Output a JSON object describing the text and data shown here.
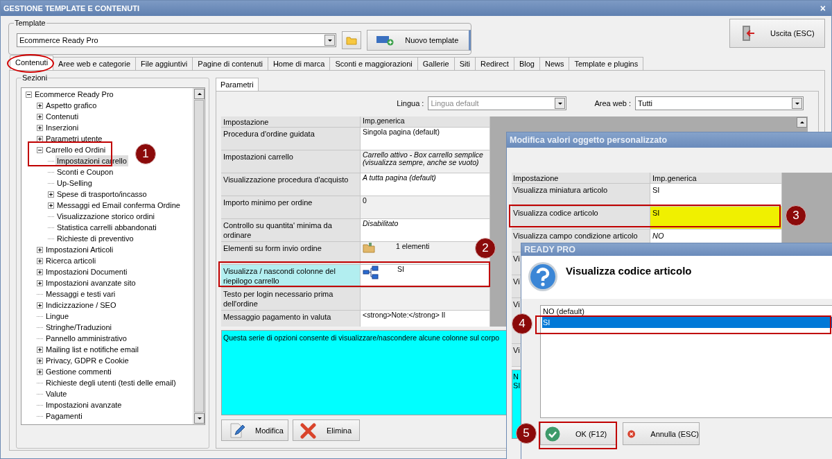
{
  "window": {
    "title": "GESTIONE TEMPLATE E CONTENUTI",
    "close": "×"
  },
  "template": {
    "legend": "Template",
    "value": "Ecommerce Ready Pro",
    "new_button": "Nuovo template"
  },
  "exit_button": "Uscita (ESC)",
  "tabs": [
    {
      "label": "Contenuti",
      "selected": true
    },
    {
      "label": "Aree web e categorie",
      "selected": false
    },
    {
      "label": "File aggiuntivi",
      "selected": false
    },
    {
      "label": "Pagine di contenuti",
      "selected": false
    },
    {
      "label": "Home di marca",
      "selected": false
    },
    {
      "label": "Sconti e maggiorazioni",
      "selected": false
    },
    {
      "label": "Gallerie",
      "selected": false
    },
    {
      "label": "Siti",
      "selected": false
    },
    {
      "label": "Redirect",
      "selected": false
    },
    {
      "label": "Blog",
      "selected": false
    },
    {
      "label": "News",
      "selected": false
    },
    {
      "label": "Template e plugins",
      "selected": false
    }
  ],
  "sections": {
    "legend": "Sezioni",
    "tree": [
      {
        "label": "Ecommerce Ready Pro",
        "kind": "node",
        "expanded": true,
        "selected": false,
        "children": [
          {
            "label": "Aspetto grafico",
            "kind": "node",
            "expanded": false,
            "selected": false
          },
          {
            "label": "Contenuti",
            "kind": "node",
            "expanded": false,
            "selected": false
          },
          {
            "label": "Inserzioni",
            "kind": "node",
            "expanded": false,
            "selected": false
          },
          {
            "label": "Parametri utente",
            "kind": "node",
            "expanded": false,
            "selected": false
          },
          {
            "label": "Carrello ed Ordini",
            "kind": "node",
            "expanded": true,
            "selected": false,
            "children": [
              {
                "label": "Impostazioni carrello",
                "kind": "leaf",
                "selected": true
              },
              {
                "label": "Sconti e Coupon",
                "kind": "leaf",
                "selected": false
              },
              {
                "label": "Up-Selling",
                "kind": "leaf",
                "selected": false
              },
              {
                "label": "Spese di trasporto/incasso",
                "kind": "node",
                "expanded": false,
                "selected": false
              },
              {
                "label": "Messaggi ed Email conferma Ordine",
                "kind": "node",
                "expanded": false,
                "selected": false
              },
              {
                "label": "Visualizzazione storico ordini",
                "kind": "leaf",
                "selected": false
              },
              {
                "label": "Statistica carrelli abbandonati",
                "kind": "leaf",
                "selected": false
              },
              {
                "label": "Richieste di preventivo",
                "kind": "leaf",
                "selected": false
              }
            ]
          },
          {
            "label": "Impostazioni Articoli",
            "kind": "node",
            "expanded": false,
            "selected": false
          },
          {
            "label": "Ricerca articoli",
            "kind": "node",
            "expanded": false,
            "selected": false
          },
          {
            "label": "Impostazioni Documenti",
            "kind": "node",
            "expanded": false,
            "selected": false
          },
          {
            "label": "Impostazioni avanzate sito",
            "kind": "node",
            "expanded": false,
            "selected": false
          },
          {
            "label": "Messaggi e testi vari",
            "kind": "leaf",
            "selected": false
          },
          {
            "label": "Indicizzazione / SEO",
            "kind": "node",
            "expanded": false,
            "selected": false
          },
          {
            "label": "Lingue",
            "kind": "leaf",
            "selected": false
          },
          {
            "label": "Stringhe/Traduzioni",
            "kind": "leaf",
            "selected": false
          },
          {
            "label": "Pannello amministrativo",
            "kind": "leaf",
            "selected": false
          },
          {
            "label": "Mailing list e notifiche email",
            "kind": "node",
            "expanded": false,
            "selected": false
          },
          {
            "label": "Privacy, GDPR e Cookie",
            "kind": "node",
            "expanded": false,
            "selected": false
          },
          {
            "label": "Gestione commenti",
            "kind": "node",
            "expanded": false,
            "selected": false
          },
          {
            "label": "Richieste degli utenti (testi delle email)",
            "kind": "leaf",
            "selected": false
          },
          {
            "label": "Valute",
            "kind": "leaf",
            "selected": false
          },
          {
            "label": "Impostazioni avanzate",
            "kind": "leaf",
            "selected": false
          },
          {
            "label": "Pagamenti",
            "kind": "leaf",
            "selected": false
          }
        ]
      }
    ]
  },
  "params": {
    "tab": "Parametri",
    "language_label": "Lingua :",
    "language_placeholder": "Lingua default",
    "area_label": "Area web :",
    "area_value": "Tutti",
    "columns": [
      "Impostazione",
      "Imp.generica"
    ],
    "rows": [
      {
        "label": "Procedura d'ordine guidata",
        "value": "Singola pagina (default)",
        "kind": "text",
        "italic": false,
        "selected": false
      },
      {
        "label": "Impostazioni carrello",
        "value": "Carrello attivo - Box carrello semplice (visualizza sempre, anche se vuoto)",
        "kind": "text",
        "italic": true,
        "selected": false
      },
      {
        "label": "Visualizzazione procedura d'acquisto",
        "value": "A tutta pagina (default)",
        "kind": "text",
        "italic": true,
        "selected": false
      },
      {
        "label": "Importo minimo per ordine",
        "value": "0",
        "kind": "text",
        "italic": false,
        "selected": false
      },
      {
        "label": "Controllo su quantita' minima da ordinare",
        "value": "Disabilitato",
        "kind": "text",
        "italic": true,
        "selected": false
      },
      {
        "label": "Elementi su form invio ordine",
        "value": "1 elementi",
        "kind": "folder",
        "italic": false,
        "selected": false
      },
      {
        "label": "Visualizza / nascondi colonne del riepilogo carrello",
        "value": "SI",
        "kind": "tree",
        "italic": false,
        "selected": true
      },
      {
        "label": "Testo per login necessario prima dell'ordine",
        "kind": "text",
        "selected": false
      },
      {
        "label": "Messaggio pagamento in valuta",
        "value": "<strong>Note:</strong> Il",
        "kind": "text",
        "italic": false,
        "selected": false
      }
    ],
    "description": "Questa serie di opzioni consente di visualizzare/nascondere alcune colonne sul corpo",
    "buttons": [
      {
        "label": "Modifica",
        "kind": "edit"
      },
      {
        "label": "Elimina",
        "kind": "delete"
      }
    ]
  },
  "edit_dialog": {
    "title": "Modifica valori oggetto personalizzato",
    "columns": [
      "Impostazione",
      "Imp.generica"
    ],
    "rows": [
      {
        "label": "Visualizza miniatura articolo",
        "value": "SI",
        "italic": false,
        "selected": false
      },
      {
        "label": "Visualizza codice articolo",
        "value": "SI",
        "italic": false,
        "selected": true
      },
      {
        "label": "Visualizza campo condizione articolo",
        "value": "NO",
        "italic": true,
        "selected": false
      },
      {
        "label": "Vi"
      },
      {
        "label": "Vi"
      },
      {
        "label": "Vi"
      },
      {},
      {
        "label": "Vi"
      }
    ],
    "description": [
      "N",
      "SI"
    ]
  },
  "choice_dialog": {
    "title": "READY PRO",
    "question": "Visualizza codice articolo",
    "options": [
      {
        "label": "NO (default)",
        "selected": false
      },
      {
        "label": "SI",
        "selected": true
      }
    ],
    "buttons": [
      {
        "label": "OK (F12)",
        "kind": "ok"
      },
      {
        "label": "Annulla (ESC)",
        "kind": "cancel"
      }
    ]
  },
  "annotations": [
    {
      "kind": "ellipse"
    },
    {
      "kind": "numbered",
      "label": "1"
    },
    {
      "kind": "numbered",
      "label": "2"
    },
    {
      "kind": "numbered",
      "label": "3"
    },
    {
      "kind": "numbered",
      "label": "4"
    },
    {
      "kind": "numbered",
      "label": "5"
    }
  ]
}
